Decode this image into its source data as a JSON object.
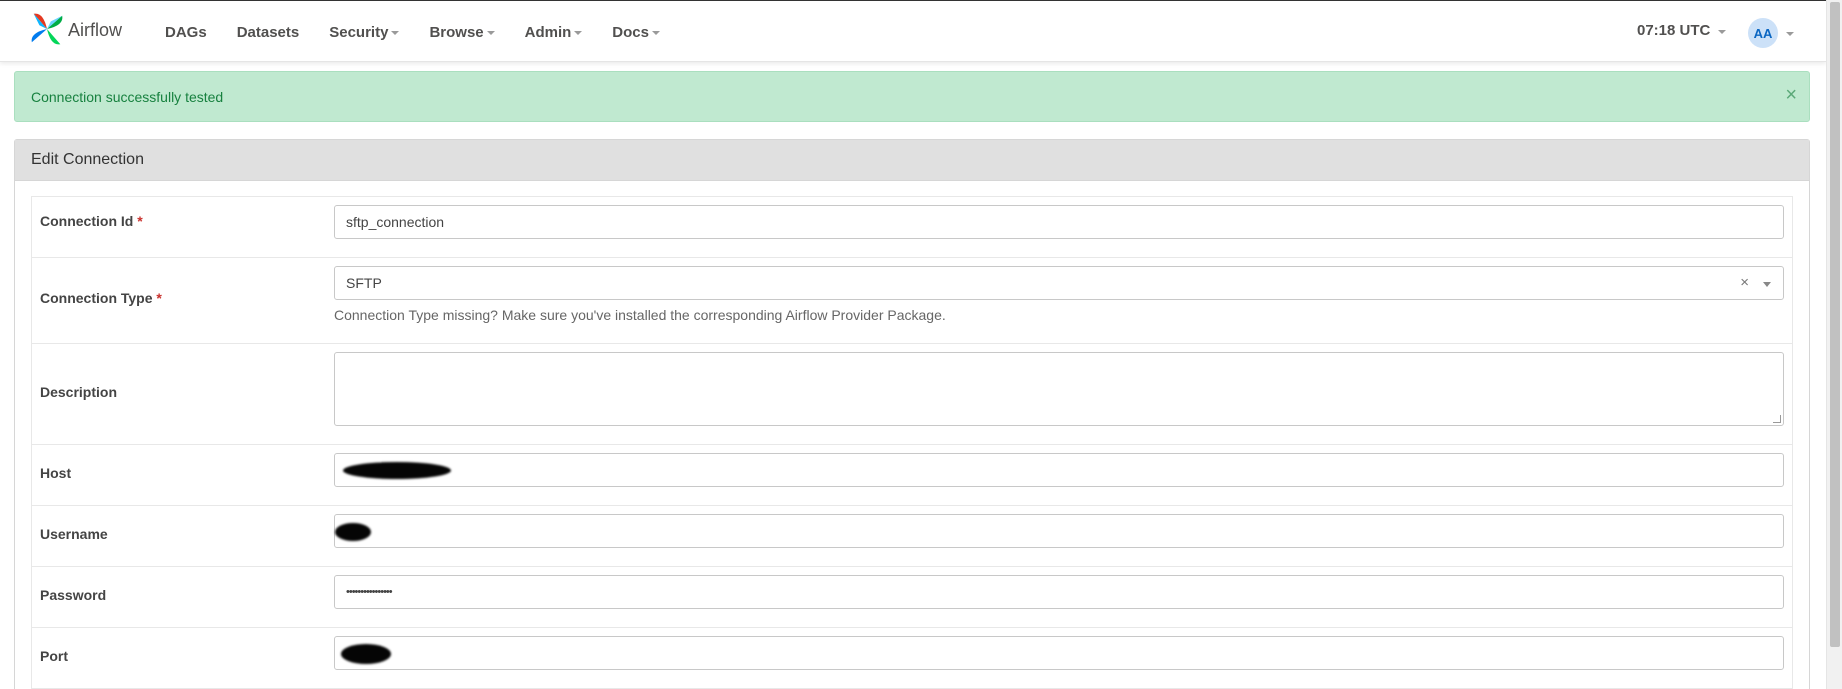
{
  "brand": {
    "name": "Airflow"
  },
  "nav": {
    "items": [
      {
        "label": "DAGs",
        "dropdown": false
      },
      {
        "label": "Datasets",
        "dropdown": false
      },
      {
        "label": "Security",
        "dropdown": true
      },
      {
        "label": "Browse",
        "dropdown": true
      },
      {
        "label": "Admin",
        "dropdown": true
      },
      {
        "label": "Docs",
        "dropdown": true
      }
    ],
    "clock": "07:18 UTC",
    "user_initials": "AA"
  },
  "alert": {
    "message": "Connection successfully tested",
    "close_symbol": "×"
  },
  "panel": {
    "title": "Edit Connection"
  },
  "form": {
    "connection_id": {
      "label": "Connection Id",
      "required_mark": "*",
      "value": "sftp_connection"
    },
    "connection_type": {
      "label": "Connection Type",
      "required_mark": "*",
      "value": "SFTP",
      "clear_symbol": "×",
      "help": "Connection Type missing? Make sure you've installed the corresponding Airflow Provider Package."
    },
    "description": {
      "label": "Description",
      "value": ""
    },
    "host": {
      "label": "Host",
      "value_redacted": true
    },
    "username": {
      "label": "Username",
      "value_redacted": true
    },
    "password": {
      "label": "Password",
      "value": "••••••••••••••••"
    },
    "port": {
      "label": "Port",
      "value_redacted": true
    }
  },
  "colors": {
    "alert_bg": "#c0e9d0",
    "alert_text": "#17813f",
    "panel_heading_bg": "#e0e0e0",
    "required": "#c9302c",
    "avatar_bg": "#cce1f8"
  }
}
